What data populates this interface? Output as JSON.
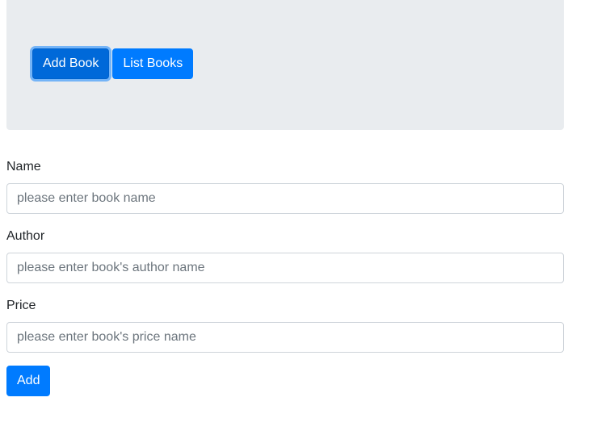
{
  "header": {
    "buttons": [
      {
        "label": "Add Book",
        "active": true
      },
      {
        "label": "List Books",
        "active": false
      }
    ]
  },
  "form": {
    "fields": [
      {
        "label": "Name",
        "value": "",
        "placeholder": "please enter book name"
      },
      {
        "label": "Author",
        "value": "",
        "placeholder": "please enter book's author name"
      },
      {
        "label": "Price",
        "value": "",
        "placeholder": "please enter book's price name"
      }
    ],
    "submit_label": "Add"
  },
  "colors": {
    "primary": "#007bff",
    "jumbotron_bg": "#e9ecef",
    "input_border": "#ced4da",
    "placeholder": "#6c757d",
    "text": "#212529"
  }
}
